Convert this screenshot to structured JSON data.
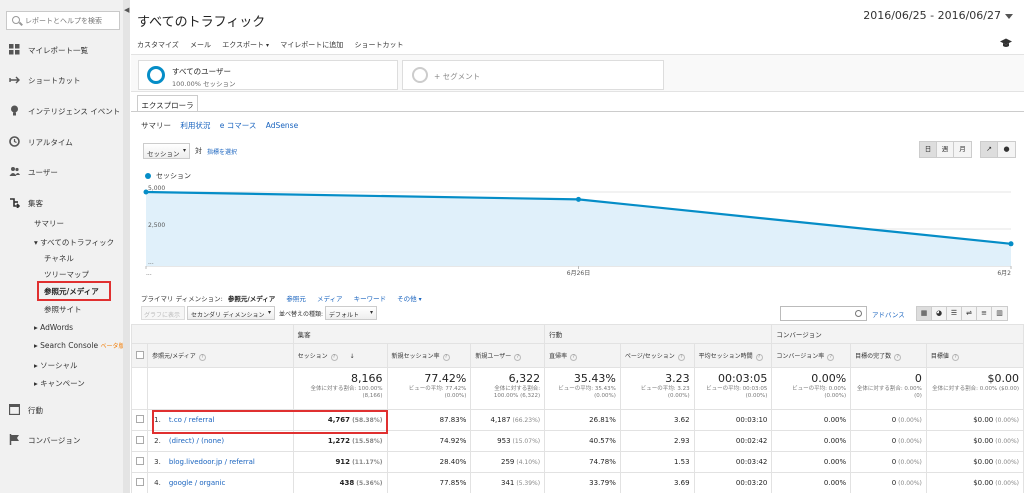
{
  "sidebar": {
    "search_placeholder": "レポートとヘルプを検索",
    "collapse_glyph": "◀",
    "items": [
      {
        "label": "マイレポート一覧",
        "icon": "dashboard-icon"
      },
      {
        "label": "ショートカット",
        "icon": "shortcut-icon"
      },
      {
        "label": "インテリジェンス イベント",
        "icon": "lightbulb-icon"
      },
      {
        "label": "リアルタイム",
        "icon": "clock-icon"
      },
      {
        "label": "ユーザー",
        "icon": "users-icon"
      },
      {
        "label": "集客",
        "icon": "acquisition-icon"
      },
      {
        "label": "行動",
        "icon": "behavior-icon"
      },
      {
        "label": "コンバージョン",
        "icon": "flag-icon"
      }
    ],
    "acquisition": {
      "summary": "サマリー",
      "all_traffic": "▾ すべてのトラフィック",
      "channels": "チャネル",
      "treemap": "ツリーマップ",
      "referral_medium": "参照元/メディア",
      "referrals": "参照サイト",
      "adwords": "▸ AdWords",
      "search_console": "▸ Search Console",
      "search_console_badge": "ベータ版",
      "social": "▸ ソーシャル",
      "campaigns": "▸ キャンペーン"
    }
  },
  "header": {
    "title": "すべてのトラフィック",
    "date_range": "2016/06/25 - 2016/06/27",
    "toolbar": [
      "カスタマイズ",
      "メール",
      "エクスポート",
      "マイレポートに追加",
      "ショートカット"
    ],
    "cap_icon": "graduation-cap-icon"
  },
  "segments": {
    "active_name": "すべてのユーザー",
    "active_sub": "100.00% セッション",
    "add_label": "+ セグメント"
  },
  "explorer": {
    "tab": "エクスプローラ",
    "subtabs": [
      "サマリー",
      "利用状況",
      "e コマース",
      "AdSense"
    ]
  },
  "chart_controls": {
    "metric": "セッション",
    "vs": "対",
    "pick_metric": "指標を選択",
    "periods": [
      "日",
      "週",
      "月"
    ],
    "chart_types": [
      "↗",
      "●"
    ]
  },
  "chart_data": {
    "type": "line",
    "series": [
      {
        "name": "セッション",
        "values": [
          5000,
          4500,
          1500
        ]
      }
    ],
    "x": [
      "6月25日",
      "6月26日",
      "6月27日"
    ],
    "x_tick_labels": [
      "...",
      "6月26日",
      "6月2"
    ],
    "y_tick_labels": [
      "5,000",
      "2,500",
      "..."
    ],
    "color": "#058dc7",
    "area_fill": "#e0f0fa",
    "ylim": [
      0,
      5000
    ],
    "grid": true
  },
  "dimensions": {
    "label": "プライマリ ディメンション:",
    "current": "参照元/メディア",
    "links": [
      "参照元",
      "メディア",
      "キーワード"
    ],
    "other": "その他"
  },
  "table_toolbar": {
    "plot_rows": "グラフに表示",
    "secondary_dim": "セカンダリ ディメンション",
    "sort_label": "並べ替えの種類:",
    "sort_value": "デフォルト",
    "advanced": "アドバンス",
    "view_icons": [
      "▦",
      "◕",
      "☰",
      "⇌",
      "≡",
      "▥"
    ]
  },
  "table": {
    "groups": [
      "集客",
      "行動",
      "コンバージョン"
    ],
    "dim_header": "参照元/メディア",
    "headers": [
      "セッション",
      "新規セッション率",
      "新規ユーザー",
      "直帰率",
      "ページ/セッション",
      "平均セッション時間",
      "コンバージョン率",
      "目標の完了数",
      "目標値"
    ],
    "sort_arrow": "↓",
    "totals": [
      {
        "big": "8,166",
        "sm": "全体に対する割合: 100.00% (8,166)"
      },
      {
        "big": "77.42%",
        "sm": "ビューの平均: 77.42% (0.00%)"
      },
      {
        "big": "6,322",
        "sm": "全体に対する割合: 100.00% (6,322)"
      },
      {
        "big": "35.43%",
        "sm": "ビューの平均: 35.43% (0.00%)"
      },
      {
        "big": "3.23",
        "sm": "ビューの平均: 3.23 (0.00%)"
      },
      {
        "big": "00:03:05",
        "sm": "ビューの平均: 00:03:05 (0.00%)"
      },
      {
        "big": "0.00%",
        "sm": "ビューの平均: 0.00% (0.00%)"
      },
      {
        "big": "0",
        "sm": "全体に対する割合: 0.00% (0)"
      },
      {
        "big": "$0.00",
        "sm": "全体に対する割合: 0.00% ($0.00)"
      }
    ],
    "rows": [
      {
        "idx": "1.",
        "name": "t.co / referral",
        "sessions": "4,767",
        "sessions_pct": "(58.38%)",
        "new_rate": "87.83%",
        "new_users": "4,187",
        "new_users_pct": "(66.23%)",
        "bounce": "26.81%",
        "pps": "3.62",
        "avg_time": "00:03:10",
        "conv": "0.00%",
        "goals": "0",
        "goals_pct": "(0.00%)",
        "value": "$0.00",
        "value_pct": "(0.00%)"
      },
      {
        "idx": "2.",
        "name": "(direct) / (none)",
        "sessions": "1,272",
        "sessions_pct": "(15.58%)",
        "new_rate": "74.92%",
        "new_users": "953",
        "new_users_pct": "(15.07%)",
        "bounce": "40.57%",
        "pps": "2.93",
        "avg_time": "00:02:42",
        "conv": "0.00%",
        "goals": "0",
        "goals_pct": "(0.00%)",
        "value": "$0.00",
        "value_pct": "(0.00%)"
      },
      {
        "idx": "3.",
        "name": "blog.livedoor.jp / referral",
        "sessions": "912",
        "sessions_pct": "(11.17%)",
        "new_rate": "28.40%",
        "new_users": "259",
        "new_users_pct": "(4.10%)",
        "bounce": "74.78%",
        "pps": "1.53",
        "avg_time": "00:03:42",
        "conv": "0.00%",
        "goals": "0",
        "goals_pct": "(0.00%)",
        "value": "$0.00",
        "value_pct": "(0.00%)"
      },
      {
        "idx": "4.",
        "name": "google / organic",
        "sessions": "438",
        "sessions_pct": "(5.36%)",
        "new_rate": "77.85%",
        "new_users": "341",
        "new_users_pct": "(5.39%)",
        "bounce": "33.79%",
        "pps": "3.69",
        "avg_time": "00:03:20",
        "conv": "0.00%",
        "goals": "0",
        "goals_pct": "(0.00%)",
        "value": "$0.00",
        "value_pct": "(0.00%)"
      }
    ]
  }
}
